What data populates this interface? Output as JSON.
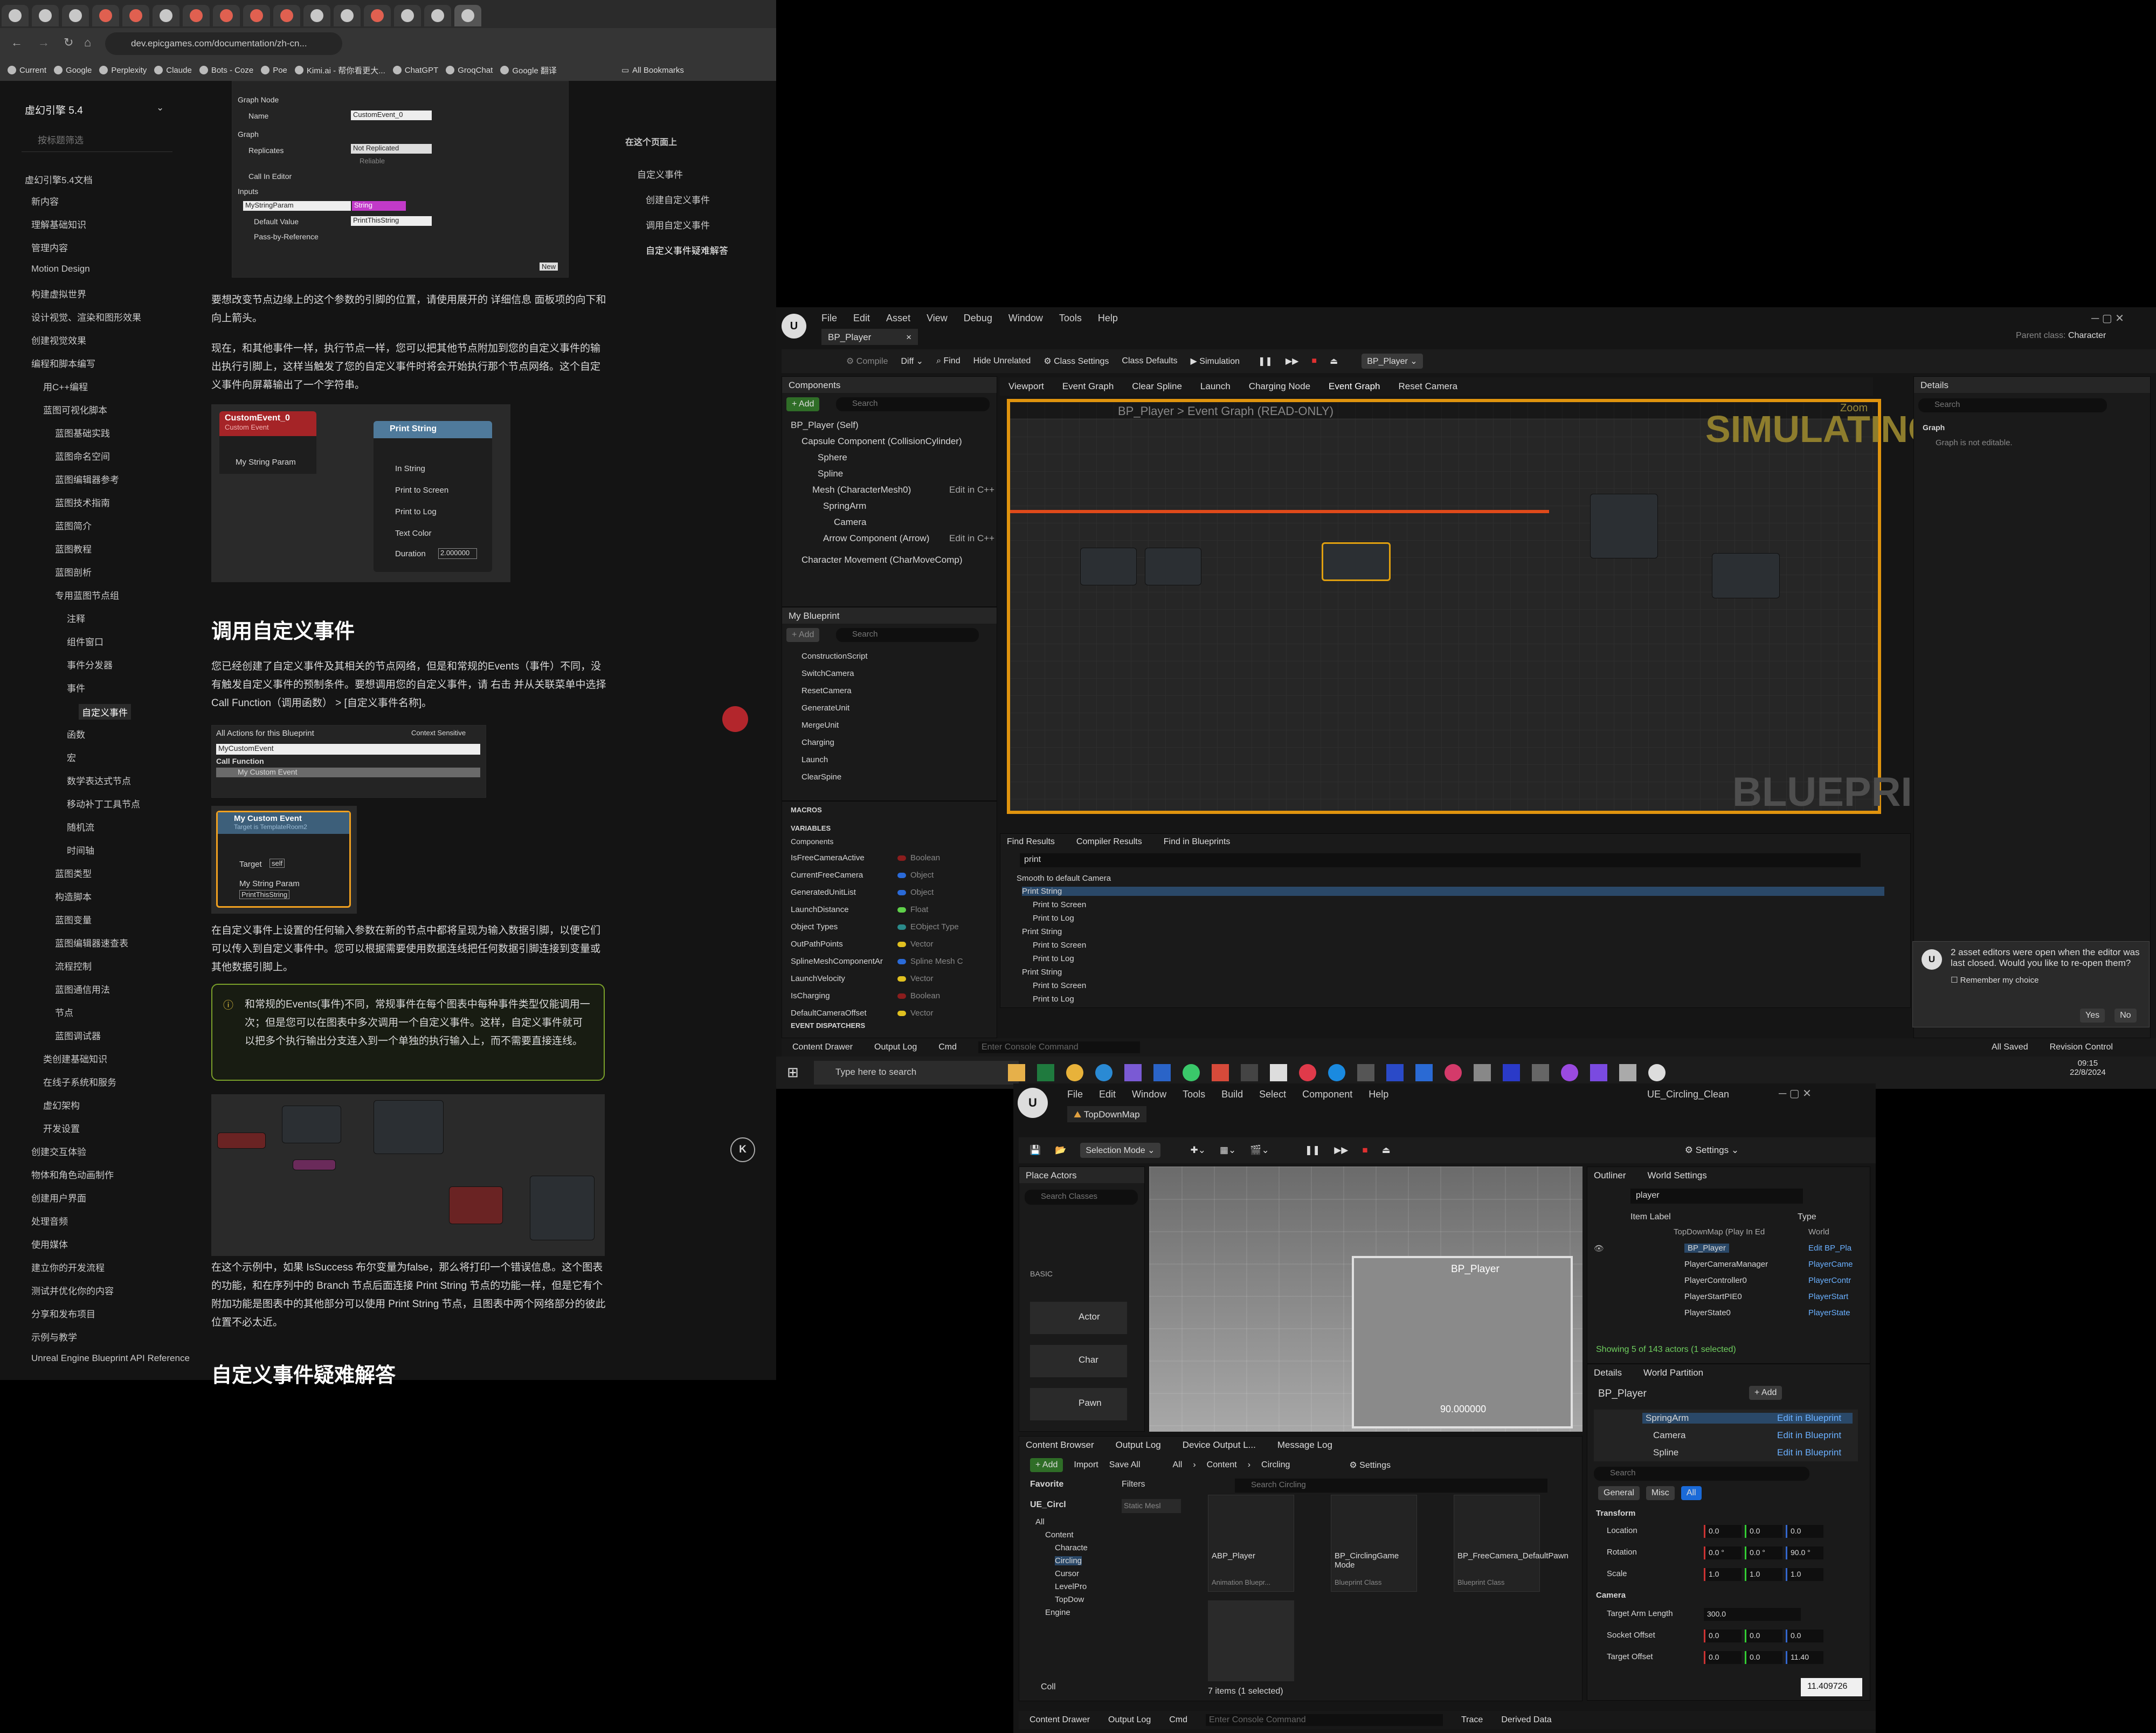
{
  "browser": {
    "url": "dev.epicgames.com/documentation/zh-cn...",
    "bookmarks": [
      "Current",
      "Google",
      "Perplexity",
      "Claude",
      "Bots - Coze",
      "Poe",
      "Kimi.ai - 帮你看更大...",
      "ChatGPT",
      "GroqChat",
      "Google 翻译"
    ],
    "all_bookmarks": "All Bookmarks",
    "sidebar": {
      "version": "虚幻引擎 5.4",
      "search_placeholder": "按标题筛选",
      "docs_label": "虚幻引擎5.4文档",
      "items": [
        "新内容",
        "理解基础知识",
        "管理内容",
        "Motion Design",
        "构建虚拟世界",
        "设计视觉、渲染和图形效果",
        "创建视觉效果",
        "编程和脚本编写",
        "用C++编程",
        "蓝图可视化脚本",
        "蓝图基础实践",
        "蓝图命名空间",
        "蓝图编辑器参考",
        "蓝图技术指南",
        "蓝图简介",
        "蓝图教程",
        "蓝图剖析",
        "专用蓝图节点组",
        "注释",
        "组件窗口",
        "事件分发器",
        "事件",
        "自定义事件",
        "函数",
        "宏",
        "数学表达式节点",
        "移动补丁工具节点",
        "随机流",
        "时间轴",
        "蓝图类型",
        "构造脚本",
        "蓝图变量",
        "蓝图编辑器速查表",
        "流程控制",
        "蓝图通信用法",
        "节点",
        "蓝图调试器",
        "类创建基础知识",
        "在线子系统和服务",
        "虚幻架构",
        "开发设置",
        "创建交互体验",
        "物体和角色动画制作",
        "创建用户界面",
        "处理音频",
        "使用媒体",
        "建立你的开发流程",
        "测试并优化你的内容",
        "分享和发布项目",
        "示例与教学",
        "Unreal Engine Blueprint API Reference"
      ]
    },
    "toc": {
      "title": "在这个页面上",
      "items": [
        "自定义事件",
        "创建自定义事件",
        "调用自定义事件",
        "自定义事件疑难解答"
      ]
    },
    "doc": {
      "para1": "要想改变节点边缘上的这个参数的引脚的位置，请使用展开的 详细信息 面板项的向下和向上箭头。",
      "para2": "现在，和其他事件一样，执行节点一样，您可以把其他节点附加到您的自定义事件的输出执行引脚上，这样当触发了您的自定义事件时将会开始执行那个节点网络。这个自定义事件向屏幕输出了一个字符串。",
      "h_call": "调用自定义事件",
      "para3": "您已经创建了自定义事件及其相关的节点网络，但是和常规的Events（事件）不同，没有触发自定义事件的预制条件。要想调用您的自定义事件，请 右击 并从关联菜单中选择 Call Function（调用函数） > [自定义事件名称]。",
      "para4": "在自定义事件上设置的任何输入参数在新的节点中都将呈现为输入数据引脚，以便它们可以传入到自定义事件中。您可以根据需要使用数据连线把任何数据引脚连接到变量或其他数据引脚上。",
      "note": "和常规的Events(事件)不同，常规事件在每个图表中每种事件类型仅能调用一次；但是您可以在图表中多次调用一个自定义事件。这样，自定义事件就可以把多个执行输出分支连入到一个单独的执行输入上，而不需要直接连线。",
      "para5": "在这个示例中，如果 IsSuccess 布尔变量为false，那么将打印一个错误信息。这个图表的功能，和在序列中的 Branch 节点后面连接 Print String 节点的功能一样，但是它有个附加功能是图表中的其他部分可以使用 Print String 节点，且图表中两个网络部分的彼此位置不必太近。",
      "h_trouble": "自定义事件疑难解答",
      "details_panel": {
        "graph_node": "Graph Node",
        "name_label": "Name",
        "name_value": "CustomEvent_0",
        "graph": "Graph",
        "replicates": "Replicates",
        "replicates_value": "Not Replicated",
        "reliable": "Reliable",
        "call_in_editor": "Call In Editor",
        "inputs": "Inputs",
        "param": "MyStringParam",
        "type": "String",
        "default_value": "Default Value",
        "default_text": "PrintThisString",
        "pass_by_ref": "Pass-by-Reference",
        "new_btn": "New"
      },
      "node1": {
        "title": "CustomEvent_0",
        "subtitle": "Custom Event",
        "pin": "My String Param"
      },
      "node2": {
        "title": "Print String",
        "pins": [
          "In String",
          "Print to Screen",
          "Print to Log",
          "Text Color",
          "Duration"
        ],
        "duration": "2.000000"
      },
      "actions": {
        "title": "All Actions for this Blueprint",
        "context": "Context Sensitive",
        "search": "MyCustomEvent",
        "category": "Call Function",
        "item": "My Custom Event"
      },
      "node3": {
        "title": "My Custom Event",
        "subtitle": "Target is TemplateRoom2",
        "target": "Target",
        "target_val": "self",
        "param": "My String Param",
        "param_val": "PrintThisString"
      }
    }
  },
  "ue1": {
    "menu": [
      "File",
      "Edit",
      "Asset",
      "View",
      "Debug",
      "Window",
      "Tools",
      "Help"
    ],
    "tab": "BP_Player",
    "parent_class_label": "Parent class:",
    "parent_class": "Character",
    "toolbar": [
      "Compile",
      "Diff",
      "Find",
      "Hide Unrelated",
      "Class Settings",
      "Class Defaults",
      "Simulation"
    ],
    "debug_target": "BP_Player",
    "components": {
      "title": "Components",
      "add": "Add",
      "search": "Search",
      "items": [
        "BP_Player (Self)",
        "Capsule Component (CollisionCylinder)",
        "Sphere",
        "Spline",
        "Mesh (CharacterMesh0)",
        "SpringArm",
        "Camera",
        "Arrow Component (Arrow)",
        "Character Movement (CharMoveComp)"
      ],
      "edit_cpp": "Edit in C++",
      "edit": "Edi"
    },
    "graph_tabs": [
      "Viewport",
      "Event Graph",
      "Clear Spline",
      "Launch",
      "Charging Node",
      "Event Graph",
      "Reset Camera"
    ],
    "breadcrumb": "BP_Player  >  Event Graph  (READ-ONLY)",
    "zoom": "Zoom",
    "simulating": "SIMULATING",
    "watermark": "BLUEPRINT",
    "details": {
      "title": "Details",
      "search": "Search",
      "graph": "Graph",
      "note": "Graph is not editable."
    },
    "myblueprint": {
      "title": "My Blueprint",
      "add": "Add",
      "search": "Search",
      "functions": [
        "ConstructionScript",
        "SwitchCamera",
        "ResetCamera",
        "GenerateUnit",
        "MergeUnit",
        "Charging",
        "Launch",
        "ClearSpine"
      ],
      "macros": "MACROS",
      "variables": "VARIABLES",
      "components_cat": "Components",
      "vars": [
        [
          "IsFreeCameraActive",
          "Boolean"
        ],
        [
          "CurrentFreeCamera",
          "Object"
        ],
        [
          "GeneratedUnitList",
          "Object"
        ],
        [
          "LaunchDistance",
          "Float"
        ],
        [
          "Object Types",
          "EObject Type"
        ],
        [
          "OutPathPoints",
          "Vector"
        ],
        [
          "SplineMeshComponentAr",
          "Spline Mesh C"
        ],
        [
          "LaunchVelocity",
          "Vector"
        ],
        [
          "IsCharging",
          "Boolean"
        ],
        [
          "DefaultCameraOffset",
          "Vector"
        ]
      ],
      "dispatchers": "EVENT DISPATCHERS"
    },
    "find": {
      "tabs": [
        "Find Results",
        "Compiler Results",
        "Find in Blueprints"
      ],
      "query": "print",
      "root": "Smooth to default Camera",
      "results": [
        "Print String",
        "Print to Screen",
        "Print to Log",
        "Print String",
        "Print to Screen",
        "Print to Log",
        "Print String",
        "Print to Screen",
        "Print to Log"
      ]
    },
    "bottom": {
      "content_drawer": "Content Drawer",
      "output_log": "Output Log",
      "cmd": "Cmd",
      "console": "Enter Console Command",
      "saved": "All Saved",
      "revision": "Revision Control"
    },
    "toast": {
      "text": "2 asset editors were open when the editor was last closed. Would you like to re-open them?",
      "remember": "Remember my choice",
      "yes": "Yes",
      "no": "No"
    }
  },
  "taskbar": {
    "search": "Type here to search",
    "time": "09:15",
    "date": "22/8/2024"
  },
  "ue2": {
    "menu": [
      "File",
      "Edit",
      "Window",
      "Tools",
      "Build",
      "Select",
      "Component",
      "Help"
    ],
    "title": "UE_Circling_Clean",
    "map": "TopDownMap",
    "selection_mode": "Selection Mode",
    "settings": "Settings",
    "place_actors": {
      "title": "Place Actors",
      "search": "Search Classes",
      "basic": "BASIC",
      "items": [
        "Actor",
        "Char",
        "Pawn"
      ]
    },
    "viewport": {
      "label": "BP_Player",
      "value": "90.000000"
    },
    "outliner": {
      "title": "Outliner",
      "world_settings": "World Settings",
      "search": "player",
      "col_label": "Item Label",
      "col_type": "Type",
      "map_row": "TopDownMap (Play In Ed",
      "map_type": "World",
      "rows": [
        [
          "BP_Player",
          "Edit BP_Pla"
        ],
        [
          "PlayerCameraManager",
          "PlayerCame"
        ],
        [
          "PlayerController0",
          "PlayerContr"
        ],
        [
          "PlayerStartPIE0",
          "PlayerStart"
        ],
        [
          "PlayerState0",
          "PlayerState"
        ]
      ],
      "status": "Showing 5 of 143 actors (1 selected)"
    },
    "details": {
      "title": "Details",
      "world_partition": "World Partition",
      "object": "BP_Player",
      "add": "Add",
      "tree": [
        "SpringArm",
        "Camera",
        "Spline"
      ],
      "edit_bp": "Edit in Blueprint",
      "search": "Search",
      "filters": [
        "General",
        "Misc",
        "All"
      ],
      "transform": "Transform",
      "location": "Location",
      "rotation": "Rotation",
      "scale": "Scale",
      "loc_vals": [
        "0.0",
        "0.0",
        "0.0"
      ],
      "rot_vals": [
        "0.0 °",
        "0.0 °",
        "90.0 °"
      ],
      "scale_vals": [
        "1.0",
        "1.0",
        "1.0"
      ],
      "camera": "Camera",
      "target_arm": "Target Arm Length",
      "target_arm_val": "300.0",
      "socket_offset": "Socket Offset",
      "socket_vals": [
        "0.0",
        "0.0",
        "0.0"
      ],
      "target_offset": "Target Offset",
      "target_vals": [
        "0.0",
        "0.0",
        "11.40"
      ],
      "tooltip": "11.409726"
    },
    "content_browser": {
      "title": "Content Browser",
      "tabs": [
        "Output Log",
        "Device Output L...",
        "Message Log"
      ],
      "add": "Add",
      "import": "Import",
      "save_all": "Save All",
      "path": [
        "All",
        "Content",
        "Circling"
      ],
      "settings": "Settings",
      "favorites": "Favorite",
      "project": "UE_Circl",
      "tree": [
        "All",
        "Content",
        "Characte",
        "Circling",
        "Cursor",
        "LevelPro",
        "TopDow",
        "Engine"
      ],
      "filters": "Filters",
      "static": "Static Mesl",
      "search": "Search Circling",
      "assets": [
        [
          "ABP_Player",
          "Animation Bluepr..."
        ],
        [
          "BP_CirclingGame Mode",
          "Blueprint Class"
        ],
        [
          "BP_FreeCamera_DefaultPawn",
          "Blueprint Class"
        ]
      ],
      "count": "7 items (1 selected)",
      "coll": "Coll"
    },
    "bottom": {
      "content_drawer": "Content Drawer",
      "output_log": "Output Log",
      "cmd": "Cmd",
      "console": "Enter Console Command",
      "trace": "Trace",
      "derived": "Derived Data"
    }
  }
}
